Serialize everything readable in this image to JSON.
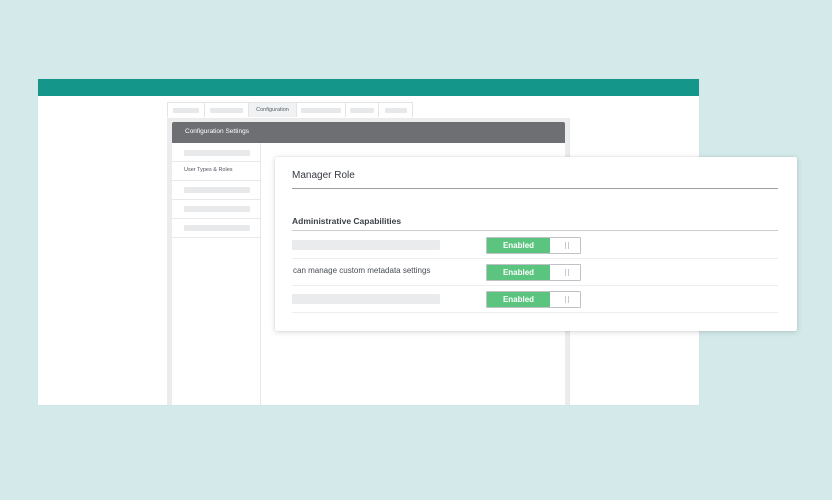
{
  "tabs": [
    {
      "label": "",
      "active": false
    },
    {
      "label": "",
      "active": false
    },
    {
      "label": "Configuration",
      "active": true
    },
    {
      "label": "",
      "active": false
    },
    {
      "label": "",
      "active": false
    },
    {
      "label": "",
      "active": false
    }
  ],
  "config": {
    "title": "Configuration Settings",
    "nav": [
      {
        "label": ""
      },
      {
        "label": "User Types & Roles"
      },
      {
        "label": ""
      },
      {
        "label": ""
      },
      {
        "label": ""
      }
    ]
  },
  "role_card": {
    "title": "Manager Role",
    "section_title": "Administrative Capabilities",
    "capabilities": [
      {
        "label": "",
        "state": "Enabled"
      },
      {
        "label": "can manage custom metadata settings",
        "state": "Enabled"
      },
      {
        "label": "",
        "state": "Enabled"
      }
    ]
  },
  "colors": {
    "brand_teal": "#14968a",
    "enabled_green": "#5bc47f",
    "header_gray": "#6d6f72",
    "background": "#d4eaea"
  }
}
